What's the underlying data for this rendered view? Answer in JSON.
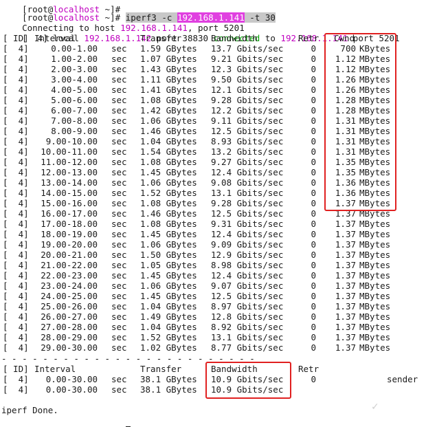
{
  "prompt": {
    "user": "root",
    "host": "localhost",
    "path": "~",
    "symbol": "]#"
  },
  "command": {
    "text": "iperf3 -c ",
    "ip": "192.168.1.141",
    "args": " -t 30"
  },
  "connecting": {
    "prefix": "Connecting to host ",
    "ip": "192.168.1.141",
    "suffix": ", port 5201"
  },
  "local": {
    "tag": "[  4] local ",
    "local_ip": "192.168.1.142",
    "port_text": " port 38830 ",
    "connected": "connected",
    "to": " to ",
    "remote_ip": "192.168.1.141",
    "remote_port": " port 5201"
  },
  "header": {
    "id": "[ ID]",
    "interval": "Interval",
    "transfer": "Transfer",
    "bandwidth": "Bandwidth",
    "retr": "Retr",
    "cwnd": "Cwnd"
  },
  "rows": [
    {
      "tag": "[  4]",
      "interval": "0.00-1.00",
      "unit": "sec",
      "transfer": "1.59 GBytes",
      "bandwidth": "13.7 Gbits/sec",
      "retr": "0",
      "cwnd": "700",
      "cwnd_unit": "KBytes"
    },
    {
      "tag": "[  4]",
      "interval": "1.00-2.00",
      "unit": "sec",
      "transfer": "1.07 GBytes",
      "bandwidth": "9.21 Gbits/sec",
      "retr": "0",
      "cwnd": "1.12",
      "cwnd_unit": "MBytes"
    },
    {
      "tag": "[  4]",
      "interval": "2.00-3.00",
      "unit": "sec",
      "transfer": "1.43 GBytes",
      "bandwidth": "12.3 Gbits/sec",
      "retr": "0",
      "cwnd": "1.12",
      "cwnd_unit": "MBytes"
    },
    {
      "tag": "[  4]",
      "interval": "3.00-4.00",
      "unit": "sec",
      "transfer": "1.11 GBytes",
      "bandwidth": "9.50 Gbits/sec",
      "retr": "0",
      "cwnd": "1.26",
      "cwnd_unit": "MBytes"
    },
    {
      "tag": "[  4]",
      "interval": "4.00-5.00",
      "unit": "sec",
      "transfer": "1.41 GBytes",
      "bandwidth": "12.1 Gbits/sec",
      "retr": "0",
      "cwnd": "1.26",
      "cwnd_unit": "MBytes"
    },
    {
      "tag": "[  4]",
      "interval": "5.00-6.00",
      "unit": "sec",
      "transfer": "1.08 GBytes",
      "bandwidth": "9.28 Gbits/sec",
      "retr": "0",
      "cwnd": "1.28",
      "cwnd_unit": "MBytes"
    },
    {
      "tag": "[  4]",
      "interval": "6.00-7.00",
      "unit": "sec",
      "transfer": "1.42 GBytes",
      "bandwidth": "12.2 Gbits/sec",
      "retr": "0",
      "cwnd": "1.28",
      "cwnd_unit": "MBytes"
    },
    {
      "tag": "[  4]",
      "interval": "7.00-8.00",
      "unit": "sec",
      "transfer": "1.06 GBytes",
      "bandwidth": "9.11 Gbits/sec",
      "retr": "0",
      "cwnd": "1.31",
      "cwnd_unit": "MBytes"
    },
    {
      "tag": "[  4]",
      "interval": "8.00-9.00",
      "unit": "sec",
      "transfer": "1.46 GBytes",
      "bandwidth": "12.5 Gbits/sec",
      "retr": "0",
      "cwnd": "1.31",
      "cwnd_unit": "MBytes"
    },
    {
      "tag": "[  4]",
      "interval": "9.00-10.00",
      "unit": "sec",
      "transfer": "1.04 GBytes",
      "bandwidth": "8.93 Gbits/sec",
      "retr": "0",
      "cwnd": "1.31",
      "cwnd_unit": "MBytes"
    },
    {
      "tag": "[  4]",
      "interval": "10.00-11.00",
      "unit": "sec",
      "transfer": "1.54 GBytes",
      "bandwidth": "13.2 Gbits/sec",
      "retr": "0",
      "cwnd": "1.31",
      "cwnd_unit": "MBytes"
    },
    {
      "tag": "[  4]",
      "interval": "11.00-12.00",
      "unit": "sec",
      "transfer": "1.08 GBytes",
      "bandwidth": "9.27 Gbits/sec",
      "retr": "0",
      "cwnd": "1.35",
      "cwnd_unit": "MBytes"
    },
    {
      "tag": "[  4]",
      "interval": "12.00-13.00",
      "unit": "sec",
      "transfer": "1.45 GBytes",
      "bandwidth": "12.4 Gbits/sec",
      "retr": "0",
      "cwnd": "1.35",
      "cwnd_unit": "MBytes"
    },
    {
      "tag": "[  4]",
      "interval": "13.00-14.00",
      "unit": "sec",
      "transfer": "1.06 GBytes",
      "bandwidth": "9.08 Gbits/sec",
      "retr": "0",
      "cwnd": "1.36",
      "cwnd_unit": "MBytes"
    },
    {
      "tag": "[  4]",
      "interval": "14.00-15.00",
      "unit": "sec",
      "transfer": "1.52 GBytes",
      "bandwidth": "13.1 Gbits/sec",
      "retr": "0",
      "cwnd": "1.36",
      "cwnd_unit": "MBytes"
    },
    {
      "tag": "[  4]",
      "interval": "15.00-16.00",
      "unit": "sec",
      "transfer": "1.08 GBytes",
      "bandwidth": "9.28 Gbits/sec",
      "retr": "0",
      "cwnd": "1.37",
      "cwnd_unit": "MBytes"
    },
    {
      "tag": "[  4]",
      "interval": "16.00-17.00",
      "unit": "sec",
      "transfer": "1.46 GBytes",
      "bandwidth": "12.5 Gbits/sec",
      "retr": "0",
      "cwnd": "1.37",
      "cwnd_unit": "MBytes"
    },
    {
      "tag": "[  4]",
      "interval": "17.00-18.00",
      "unit": "sec",
      "transfer": "1.08 GBytes",
      "bandwidth": "9.31 Gbits/sec",
      "retr": "0",
      "cwnd": "1.37",
      "cwnd_unit": "MBytes"
    },
    {
      "tag": "[  4]",
      "interval": "18.00-19.00",
      "unit": "sec",
      "transfer": "1.45 GBytes",
      "bandwidth": "12.4 Gbits/sec",
      "retr": "0",
      "cwnd": "1.37",
      "cwnd_unit": "MBytes"
    },
    {
      "tag": "[  4]",
      "interval": "19.00-20.00",
      "unit": "sec",
      "transfer": "1.06 GBytes",
      "bandwidth": "9.09 Gbits/sec",
      "retr": "0",
      "cwnd": "1.37",
      "cwnd_unit": "MBytes"
    },
    {
      "tag": "[  4]",
      "interval": "20.00-21.00",
      "unit": "sec",
      "transfer": "1.50 GBytes",
      "bandwidth": "12.9 Gbits/sec",
      "retr": "0",
      "cwnd": "1.37",
      "cwnd_unit": "MBytes"
    },
    {
      "tag": "[  4]",
      "interval": "21.00-22.00",
      "unit": "sec",
      "transfer": "1.05 GBytes",
      "bandwidth": "8.98 Gbits/sec",
      "retr": "0",
      "cwnd": "1.37",
      "cwnd_unit": "MBytes"
    },
    {
      "tag": "[  4]",
      "interval": "22.00-23.00",
      "unit": "sec",
      "transfer": "1.45 GBytes",
      "bandwidth": "12.4 Gbits/sec",
      "retr": "0",
      "cwnd": "1.37",
      "cwnd_unit": "MBytes"
    },
    {
      "tag": "[  4]",
      "interval": "23.00-24.00",
      "unit": "sec",
      "transfer": "1.06 GBytes",
      "bandwidth": "9.07 Gbits/sec",
      "retr": "0",
      "cwnd": "1.37",
      "cwnd_unit": "MBytes"
    },
    {
      "tag": "[  4]",
      "interval": "24.00-25.00",
      "unit": "sec",
      "transfer": "1.45 GBytes",
      "bandwidth": "12.5 Gbits/sec",
      "retr": "0",
      "cwnd": "1.37",
      "cwnd_unit": "MBytes"
    },
    {
      "tag": "[  4]",
      "interval": "25.00-26.00",
      "unit": "sec",
      "transfer": "1.04 GBytes",
      "bandwidth": "8.97 Gbits/sec",
      "retr": "0",
      "cwnd": "1.37",
      "cwnd_unit": "MBytes"
    },
    {
      "tag": "[  4]",
      "interval": "26.00-27.00",
      "unit": "sec",
      "transfer": "1.49 GBytes",
      "bandwidth": "12.8 Gbits/sec",
      "retr": "0",
      "cwnd": "1.37",
      "cwnd_unit": "MBytes"
    },
    {
      "tag": "[  4]",
      "interval": "27.00-28.00",
      "unit": "sec",
      "transfer": "1.04 GBytes",
      "bandwidth": "8.92 Gbits/sec",
      "retr": "0",
      "cwnd": "1.37",
      "cwnd_unit": "MBytes"
    },
    {
      "tag": "[  4]",
      "interval": "28.00-29.00",
      "unit": "sec",
      "transfer": "1.52 GBytes",
      "bandwidth": "13.1 Gbits/sec",
      "retr": "0",
      "cwnd": "1.37",
      "cwnd_unit": "MBytes"
    },
    {
      "tag": "[  4]",
      "interval": "29.00-30.00",
      "unit": "sec",
      "transfer": "1.02 GBytes",
      "bandwidth": "8.77 Gbits/sec",
      "retr": "0",
      "cwnd": "1.37",
      "cwnd_unit": "MBytes"
    }
  ],
  "separator": "- - - - - - - - - - - - - - - - - - - - - - - - -",
  "summary_header": {
    "id": "[ ID]",
    "interval": "Interval",
    "transfer": "Transfer",
    "bandwidth": "Bandwidth",
    "retr": "Retr"
  },
  "summary": [
    {
      "tag": "[  4]",
      "interval": "0.00-30.00",
      "unit": "sec",
      "transfer": "38.1 GBytes",
      "bandwidth": "10.9 Gbits/sec",
      "retr": "0",
      "role": "sender"
    },
    {
      "tag": "[  4]",
      "interval": "0.00-30.00",
      "unit": "sec",
      "transfer": "38.1 GBytes",
      "bandwidth": "10.9 Gbits/sec",
      "retr": "",
      "role": ""
    }
  ],
  "done": "iperf Done.",
  "colors": {
    "host": "#c000c0",
    "ip_highlight": "#e040e0",
    "connected": "#00a000",
    "annotation_box": "#e02020"
  }
}
